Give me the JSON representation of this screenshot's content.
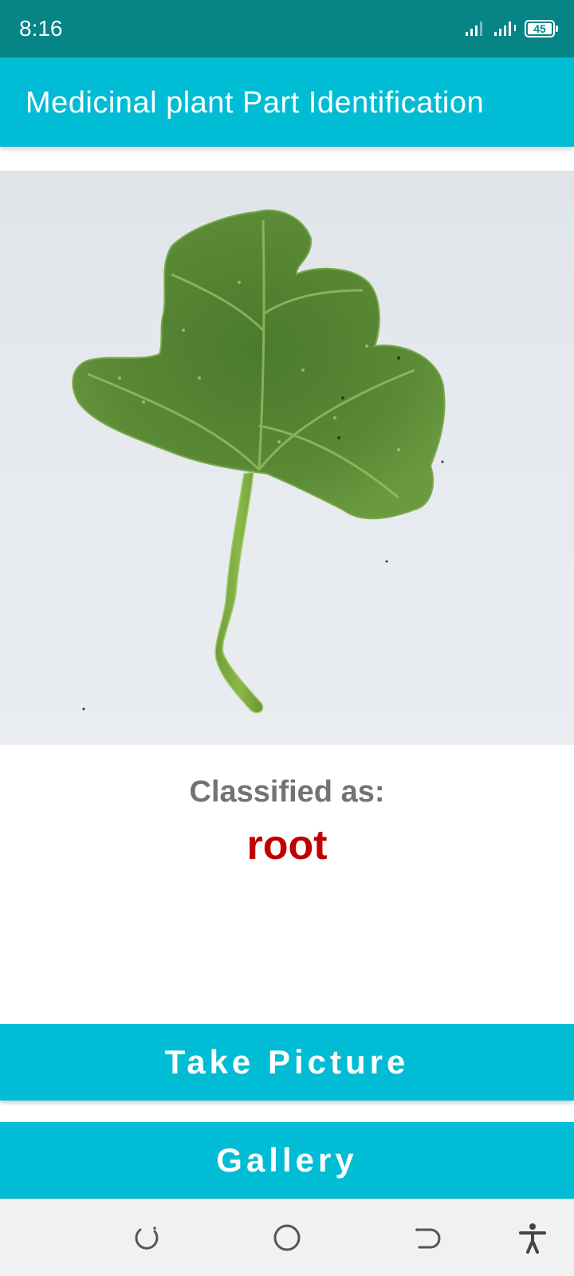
{
  "status_bar": {
    "time": "8:16",
    "battery_level": "45",
    "icons": [
      "signal-icon",
      "signal-icon",
      "battery-icon"
    ]
  },
  "app_bar": {
    "title": "Medicinal plant Part Identification"
  },
  "image": {
    "subject": "leaf"
  },
  "result": {
    "label": "Classified as:",
    "value": "root"
  },
  "buttons": {
    "take_picture": "Take Picture",
    "gallery": "Gallery"
  },
  "nav_bar": {
    "icons": [
      "recents-icon",
      "home-icon",
      "back-icon",
      "accessibility-icon"
    ]
  },
  "colors": {
    "status_bar": "#068486",
    "accent": "#00bcd4",
    "result_value": "#c00000",
    "result_label": "#737373"
  }
}
